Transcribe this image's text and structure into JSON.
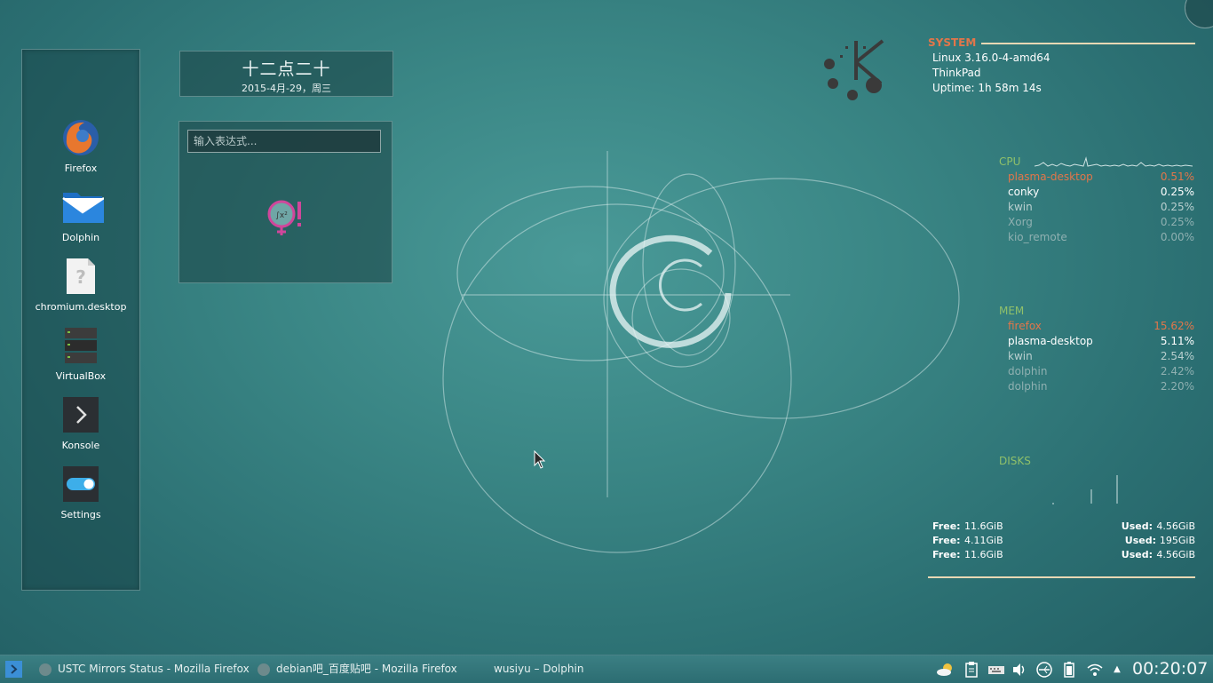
{
  "launcher": {
    "items": [
      {
        "label": "Firefox",
        "icon": "firefox-icon"
      },
      {
        "label": "Dolphin",
        "icon": "dolphin-folder-icon"
      },
      {
        "label": "chromium.desktop",
        "icon": "unknown-file-icon"
      },
      {
        "label": "VirtualBox",
        "icon": "virtualbox-icon"
      },
      {
        "label": "Konsole",
        "icon": "konsole-icon"
      },
      {
        "label": "Settings",
        "icon": "settings-toggle-icon"
      }
    ]
  },
  "clock": {
    "time": "十二点二十",
    "date": "2015-4月-29，周三"
  },
  "calculator": {
    "placeholder": "输入表达式..."
  },
  "conky": {
    "system": {
      "title": "SYSTEM",
      "kernel": "Linux 3.16.0-4-amd64",
      "host": "ThinkPad",
      "uptime": "Uptime: 1h 58m 14s"
    },
    "cpu": {
      "title": "CPU",
      "procs": [
        {
          "name": "plasma-desktop",
          "value": "0.51%"
        },
        {
          "name": "conky",
          "value": "0.25%"
        },
        {
          "name": "kwin",
          "value": "0.25%"
        },
        {
          "name": "Xorg",
          "value": "0.25%"
        },
        {
          "name": "kio_remote",
          "value": "0.00%"
        }
      ]
    },
    "mem": {
      "title": "MEM",
      "procs": [
        {
          "name": "firefox",
          "value": "15.62%"
        },
        {
          "name": "plasma-desktop",
          "value": "5.11%"
        },
        {
          "name": "kwin",
          "value": "2.54%"
        },
        {
          "name": "dolphin",
          "value": "2.42%"
        },
        {
          "name": "dolphin",
          "value": "2.20%"
        }
      ]
    },
    "disks": {
      "title": "DISKS",
      "free_label": "Free:",
      "used_label": "Used:",
      "rows": [
        {
          "free": "11.6GiB",
          "used": "4.56GiB"
        },
        {
          "free": "4.11GiB",
          "used": "195GiB"
        },
        {
          "free": "11.6GiB",
          "used": "4.56GiB"
        }
      ]
    }
  },
  "taskbar": {
    "tasks": [
      {
        "label": "USTC Mirrors Status - Mozilla Firefox",
        "icon": "firefox-icon"
      },
      {
        "label": "debian吧_百度贴吧 - Mozilla Firefox",
        "icon": "firefox-icon"
      },
      {
        "label": "wusiyu – Dolphin",
        "icon": "dolphin-icon"
      }
    ],
    "clock": "00:20:07",
    "tray_icons": [
      "weather-icon",
      "clipboard-icon",
      "keyboard-icon",
      "volume-icon",
      "usb-icon",
      "battery-icon",
      "wifi-icon",
      "expand-arrow-icon"
    ]
  },
  "colors": {
    "accent_orange": "#e2764a",
    "accent_green": "#8fc06a",
    "desktop_teal": "#3a8685"
  }
}
